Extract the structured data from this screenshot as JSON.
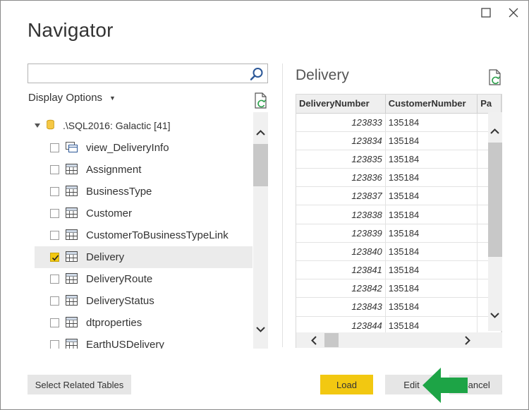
{
  "window": {
    "title": "Navigator"
  },
  "search": {
    "value": "",
    "placeholder": ""
  },
  "display_options": {
    "label": "Display Options"
  },
  "tree": {
    "server": {
      "label": ".\\SQL2016: Galactic [41]"
    },
    "items": [
      {
        "label": "view_DeliveryInfo",
        "type": "view",
        "checked": false
      },
      {
        "label": "Assignment",
        "type": "table",
        "checked": false
      },
      {
        "label": "BusinessType",
        "type": "table",
        "checked": false
      },
      {
        "label": "Customer",
        "type": "table",
        "checked": false
      },
      {
        "label": "CustomerToBusinessTypeLink",
        "type": "table",
        "checked": false
      },
      {
        "label": "Delivery",
        "type": "table",
        "checked": true
      },
      {
        "label": "DeliveryRoute",
        "type": "table",
        "checked": false
      },
      {
        "label": "DeliveryStatus",
        "type": "table",
        "checked": false
      },
      {
        "label": "dtproperties",
        "type": "table",
        "checked": false
      },
      {
        "label": "EarthUSDelivery",
        "type": "table",
        "checked": false
      }
    ]
  },
  "preview": {
    "title": "Delivery",
    "columns": [
      "DeliveryNumber",
      "CustomerNumber",
      "Pa"
    ],
    "rows": [
      [
        "123833",
        "135184"
      ],
      [
        "123834",
        "135184"
      ],
      [
        "123835",
        "135184"
      ],
      [
        "123836",
        "135184"
      ],
      [
        "123837",
        "135184"
      ],
      [
        "123838",
        "135184"
      ],
      [
        "123839",
        "135184"
      ],
      [
        "123840",
        "135184"
      ],
      [
        "123841",
        "135184"
      ],
      [
        "123842",
        "135184"
      ],
      [
        "123843",
        "135184"
      ],
      [
        "123844",
        "135184"
      ]
    ]
  },
  "buttons": {
    "select_related": "Select Related Tables",
    "load": "Load",
    "edit": "Edit",
    "cancel": "Cancel"
  },
  "icons": {
    "maximize": "maximize-icon",
    "close": "close-icon",
    "search": "search-icon",
    "refresh": "refresh-icon",
    "database": "database-icon",
    "table": "table-icon",
    "view": "view-icon",
    "annotation": "green-arrow-icon"
  },
  "colors": {
    "accent": "#f2c811",
    "annotation": "#1da446"
  }
}
